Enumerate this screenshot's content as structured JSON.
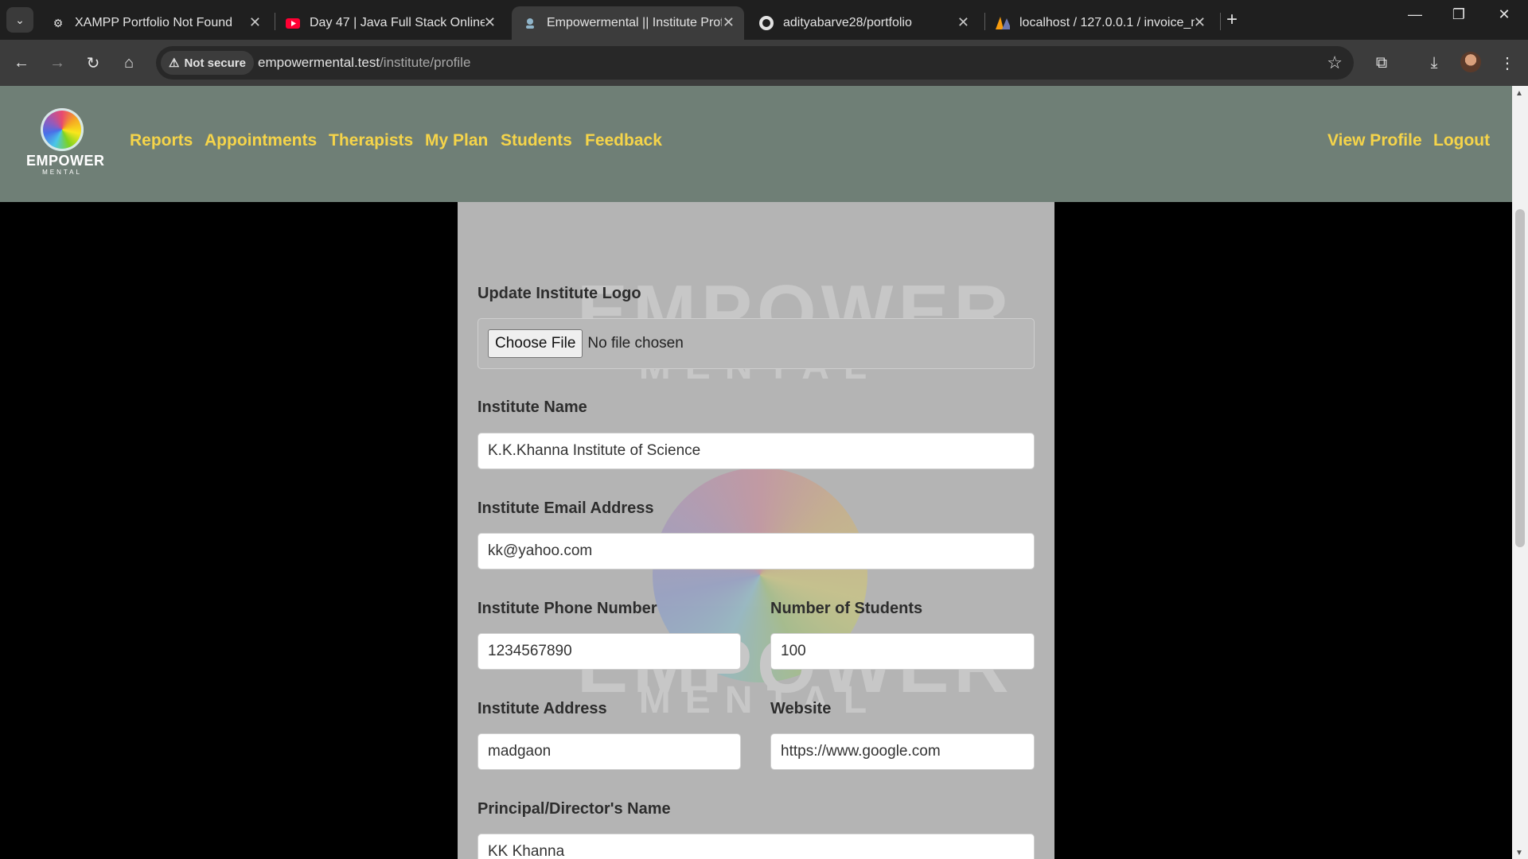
{
  "browser": {
    "tabs": [
      {
        "title": "XAMPP Portfolio Not Found",
        "icon": "xampp-icon"
      },
      {
        "title": "Day 47 | Java Full Stack Online T",
        "icon": "youtube-icon"
      },
      {
        "title": "Empowermental || Institute Prof",
        "icon": "site-icon"
      },
      {
        "title": "adityabarve28/portfolio",
        "icon": "github-icon"
      },
      {
        "title": "localhost / 127.0.0.1 / invoice_m",
        "icon": "phpmyadmin-icon"
      }
    ],
    "security_label": "Not secure",
    "url_host": "empowermental.test",
    "url_path": "/institute/profile"
  },
  "nav": {
    "logo_text": "EMPOWER",
    "logo_sub": "MENTAL",
    "links": [
      "Reports",
      "Appointments",
      "Therapists",
      "My Plan",
      "Students",
      "Feedback"
    ],
    "view_profile": "View Profile",
    "logout": "Logout"
  },
  "form": {
    "logo_label": "Update Institute Logo",
    "file_button": "Choose File",
    "file_status": "No file chosen",
    "name_label": "Institute Name",
    "name_value": "K.K.Khanna Institute of Science",
    "email_label": "Institute Email Address",
    "email_value": "kk@yahoo.com",
    "phone_label": "Institute Phone Number",
    "phone_value": "1234567890",
    "students_label": "Number of Students",
    "students_value": "100",
    "address_label": "Institute Address",
    "address_value": "madgaon",
    "website_label": "Website",
    "website_value": "https://www.google.com",
    "principal_label": "Principal/Director's Name",
    "principal_value": "KK Khanna"
  },
  "colors": {
    "navbar": "#6f7f76",
    "nav_link": "#f5d44a",
    "card": "#b4b4b4"
  }
}
